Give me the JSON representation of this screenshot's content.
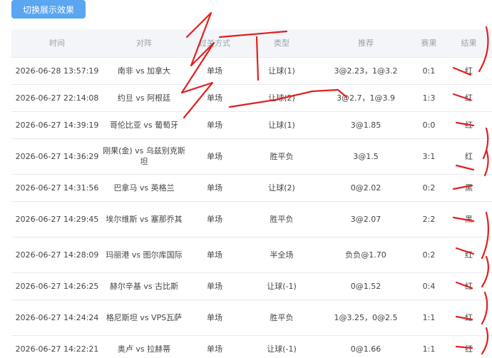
{
  "toolbar": {
    "toggle_label": "切换展示效果"
  },
  "table": {
    "headers": [
      "时间",
      "对阵",
      "过关方式",
      "类型",
      "推荐",
      "赛果",
      "结果"
    ],
    "rows": [
      {
        "time": "2026-06-28 13:57:19",
        "match": "南非 vs 加拿大",
        "mode": "单场",
        "type": "让球(1)",
        "rec": "3@2.23，1@3.2",
        "score": "0:1",
        "result": "红"
      },
      {
        "time": "2026-06-27 22:14:08",
        "match": "约旦 vs 阿根廷",
        "mode": "单场",
        "type": "让球(2)",
        "rec": "3@2.7，1@3.9",
        "score": "1:3",
        "result": "红"
      },
      {
        "time": "2026-06-27 14:39:19",
        "match": "哥伦比亚 vs 葡萄牙",
        "mode": "单场",
        "type": "让球(1)",
        "rec": "3@1.85",
        "score": "0:0",
        "result": "红"
      },
      {
        "time": "2026-06-27 14:36:29",
        "match": "刚果(金) vs 乌兹别克斯坦",
        "mode": "单场",
        "type": "胜平负",
        "rec": "3@1.5",
        "score": "3:1",
        "result": "红"
      },
      {
        "time": "2026-06-27 14:31:56",
        "match": "巴拿马 vs 英格兰",
        "mode": "单场",
        "type": "让球(2)",
        "rec": "0@2.02",
        "score": "0:2",
        "result": "黑"
      },
      {
        "time": "2026-06-27 14:29:45",
        "match": "埃尔维斯 vs 塞那乔其",
        "mode": "单场",
        "type": "胜平负",
        "rec": "3@2.07",
        "score": "2:2",
        "result": "黑"
      },
      {
        "time": "2026-06-27 14:28:09",
        "match": "玛丽港 vs 图尔库国际",
        "mode": "单场",
        "type": "半全场",
        "rec": "负负@1.70",
        "score": "0:2",
        "result": "红"
      },
      {
        "time": "2026-06-27 14:26:25",
        "match": "赫尔辛基 vs 古比斯",
        "mode": "单场",
        "type": "让球(-1)",
        "rec": "0@1.52",
        "score": "0:4",
        "result": "红"
      },
      {
        "time": "2026-06-27 14:24:24",
        "match": "格尼斯坦 vs VPS瓦萨",
        "mode": "单场",
        "type": "胜平负",
        "rec": "1@3.25，0@2.5",
        "score": "1:1",
        "result": "红"
      },
      {
        "time": "2026-06-27 14:22:21",
        "match": "奥卢 vs 拉赫蒂",
        "mode": "单场",
        "type": "让球(-1)",
        "rec": "0@1.66",
        "score": "1:1",
        "result": "红"
      }
    ]
  },
  "colors": {
    "accent": "#5aa6f0",
    "annotation_ink": "#e02020",
    "header_bg": "#f3f5f8"
  }
}
